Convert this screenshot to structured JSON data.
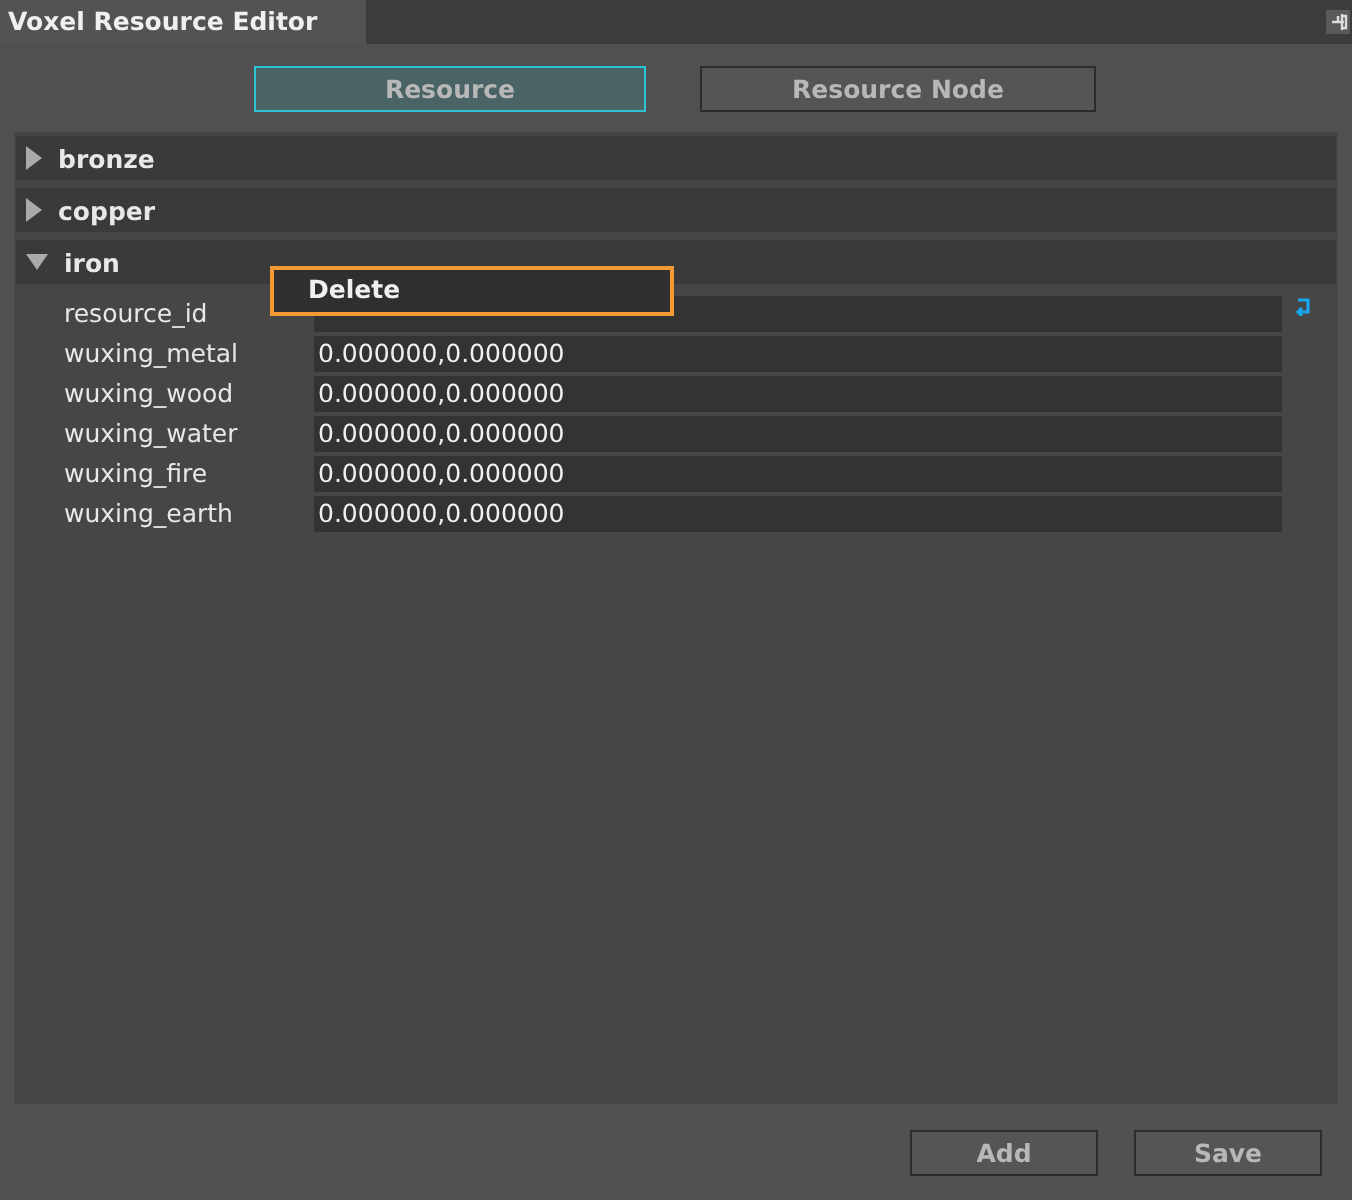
{
  "window": {
    "title": "Voxel Resource Editor"
  },
  "tabs": [
    {
      "label": "Resource",
      "selected": true
    },
    {
      "label": "Resource Node",
      "selected": false
    }
  ],
  "resources": [
    {
      "name": "bronze",
      "expanded": false
    },
    {
      "name": "copper",
      "expanded": false
    },
    {
      "name": "iron",
      "expanded": true,
      "properties": [
        {
          "name": "resource_id"
        },
        {
          "name": "wuxing_metal",
          "value": "0.000000,0.000000"
        },
        {
          "name": "wuxing_wood",
          "value": "0.000000,0.000000"
        },
        {
          "name": "wuxing_water",
          "value": "0.000000,0.000000"
        },
        {
          "name": "wuxing_fire",
          "value": "0.000000,0.000000"
        },
        {
          "name": "wuxing_earth",
          "value": "0.000000,0.000000"
        }
      ]
    }
  ],
  "context_menu": {
    "items": [
      "Delete"
    ]
  },
  "buttons": [
    "Add",
    "Save"
  ]
}
